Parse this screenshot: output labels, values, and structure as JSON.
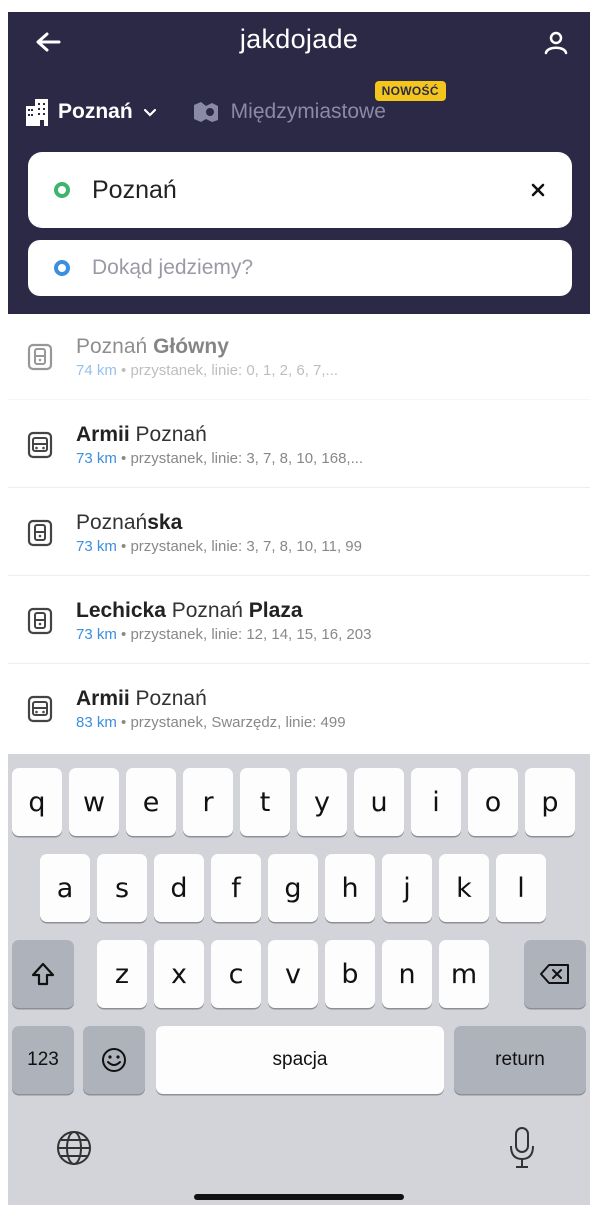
{
  "header": {
    "title": "jakdojade",
    "city": "Poznań",
    "intercity_label": "Międzymiastowe",
    "new_badge": "NOWOŚĆ"
  },
  "search": {
    "from_value": "Poznań",
    "to_placeholder": "Dokąd jedziemy?"
  },
  "results": [
    {
      "plain1": "Poznań ",
      "bold1": "Główny",
      "plain2": "",
      "bold2": "",
      "km": "74 km",
      "details": " • przystanek, linie: 0, 1, 2, 6, 7,..."
    },
    {
      "plain1": "",
      "bold1": "Armii",
      "plain2": " Poznań",
      "bold2": "",
      "km": "73 km",
      "details": " • przystanek, linie: 3, 7, 8, 10, 168,..."
    },
    {
      "plain1": "Poznań",
      "bold1": "ska",
      "plain2": "",
      "bold2": "",
      "km": "73 km",
      "details": " • przystanek, linie: 3, 7, 8, 10, 11, 99"
    },
    {
      "plain1": "",
      "bold1": "Lechicka",
      "plain2": " Poznań ",
      "bold2": "Plaza",
      "km": "73 km",
      "details": " • przystanek, linie: 12, 14, 15, 16, 203"
    },
    {
      "plain1": "",
      "bold1": "Armii",
      "plain2": " Poznań",
      "bold2": "",
      "km": "83 km",
      "details": " • przystanek, Swarzędz, linie: 499"
    }
  ],
  "keyboard": {
    "row1": [
      "q",
      "w",
      "e",
      "r",
      "t",
      "y",
      "u",
      "i",
      "o",
      "p"
    ],
    "row2": [
      "a",
      "s",
      "d",
      "f",
      "g",
      "h",
      "j",
      "k",
      "l"
    ],
    "row3": [
      "z",
      "x",
      "c",
      "v",
      "b",
      "n",
      "m"
    ],
    "numbers_key": "123",
    "space_key": "spacja",
    "return_key": "return"
  },
  "colors": {
    "header_bg": "#2b2946",
    "accent_blue": "#3a8fe0",
    "accent_green": "#3fb46a",
    "badge_yellow": "#f3c61d"
  }
}
